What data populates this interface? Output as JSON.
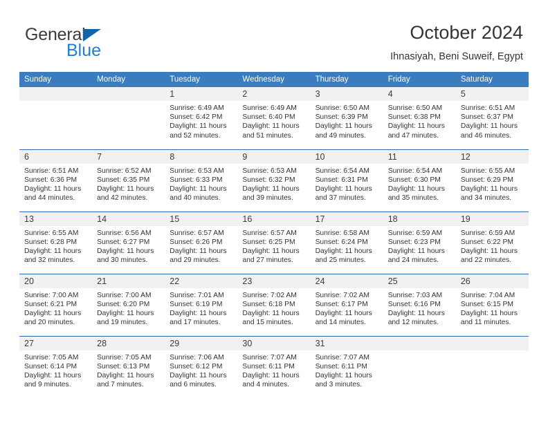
{
  "brand": {
    "name_part1": "General",
    "name_part2": "Blue",
    "triangle_icon": "triangle-icon"
  },
  "header": {
    "title": "October 2024",
    "subtitle": "Ihnasiyah, Beni Suweif, Egypt"
  },
  "colors": {
    "header_blue": "#3A7CC0",
    "row_divider_blue": "#2A6DB5",
    "daynum_band": "#F1F1F1",
    "brand_blue": "#1F7FD4",
    "text": "#333333"
  },
  "calendar": {
    "weekday_headers": [
      "Sunday",
      "Monday",
      "Tuesday",
      "Wednesday",
      "Thursday",
      "Friday",
      "Saturday"
    ],
    "weeks": [
      [
        {
          "day": "",
          "sunrise": "",
          "sunset": "",
          "daylight_line1": "",
          "daylight_line2": ""
        },
        {
          "day": "",
          "sunrise": "",
          "sunset": "",
          "daylight_line1": "",
          "daylight_line2": ""
        },
        {
          "day": "1",
          "sunrise": "Sunrise: 6:49 AM",
          "sunset": "Sunset: 6:42 PM",
          "daylight_line1": "Daylight: 11 hours",
          "daylight_line2": "and 52 minutes."
        },
        {
          "day": "2",
          "sunrise": "Sunrise: 6:49 AM",
          "sunset": "Sunset: 6:40 PM",
          "daylight_line1": "Daylight: 11 hours",
          "daylight_line2": "and 51 minutes."
        },
        {
          "day": "3",
          "sunrise": "Sunrise: 6:50 AM",
          "sunset": "Sunset: 6:39 PM",
          "daylight_line1": "Daylight: 11 hours",
          "daylight_line2": "and 49 minutes."
        },
        {
          "day": "4",
          "sunrise": "Sunrise: 6:50 AM",
          "sunset": "Sunset: 6:38 PM",
          "daylight_line1": "Daylight: 11 hours",
          "daylight_line2": "and 47 minutes."
        },
        {
          "day": "5",
          "sunrise": "Sunrise: 6:51 AM",
          "sunset": "Sunset: 6:37 PM",
          "daylight_line1": "Daylight: 11 hours",
          "daylight_line2": "and 46 minutes."
        }
      ],
      [
        {
          "day": "6",
          "sunrise": "Sunrise: 6:51 AM",
          "sunset": "Sunset: 6:36 PM",
          "daylight_line1": "Daylight: 11 hours",
          "daylight_line2": "and 44 minutes."
        },
        {
          "day": "7",
          "sunrise": "Sunrise: 6:52 AM",
          "sunset": "Sunset: 6:35 PM",
          "daylight_line1": "Daylight: 11 hours",
          "daylight_line2": "and 42 minutes."
        },
        {
          "day": "8",
          "sunrise": "Sunrise: 6:53 AM",
          "sunset": "Sunset: 6:33 PM",
          "daylight_line1": "Daylight: 11 hours",
          "daylight_line2": "and 40 minutes."
        },
        {
          "day": "9",
          "sunrise": "Sunrise: 6:53 AM",
          "sunset": "Sunset: 6:32 PM",
          "daylight_line1": "Daylight: 11 hours",
          "daylight_line2": "and 39 minutes."
        },
        {
          "day": "10",
          "sunrise": "Sunrise: 6:54 AM",
          "sunset": "Sunset: 6:31 PM",
          "daylight_line1": "Daylight: 11 hours",
          "daylight_line2": "and 37 minutes."
        },
        {
          "day": "11",
          "sunrise": "Sunrise: 6:54 AM",
          "sunset": "Sunset: 6:30 PM",
          "daylight_line1": "Daylight: 11 hours",
          "daylight_line2": "and 35 minutes."
        },
        {
          "day": "12",
          "sunrise": "Sunrise: 6:55 AM",
          "sunset": "Sunset: 6:29 PM",
          "daylight_line1": "Daylight: 11 hours",
          "daylight_line2": "and 34 minutes."
        }
      ],
      [
        {
          "day": "13",
          "sunrise": "Sunrise: 6:55 AM",
          "sunset": "Sunset: 6:28 PM",
          "daylight_line1": "Daylight: 11 hours",
          "daylight_line2": "and 32 minutes."
        },
        {
          "day": "14",
          "sunrise": "Sunrise: 6:56 AM",
          "sunset": "Sunset: 6:27 PM",
          "daylight_line1": "Daylight: 11 hours",
          "daylight_line2": "and 30 minutes."
        },
        {
          "day": "15",
          "sunrise": "Sunrise: 6:57 AM",
          "sunset": "Sunset: 6:26 PM",
          "daylight_line1": "Daylight: 11 hours",
          "daylight_line2": "and 29 minutes."
        },
        {
          "day": "16",
          "sunrise": "Sunrise: 6:57 AM",
          "sunset": "Sunset: 6:25 PM",
          "daylight_line1": "Daylight: 11 hours",
          "daylight_line2": "and 27 minutes."
        },
        {
          "day": "17",
          "sunrise": "Sunrise: 6:58 AM",
          "sunset": "Sunset: 6:24 PM",
          "daylight_line1": "Daylight: 11 hours",
          "daylight_line2": "and 25 minutes."
        },
        {
          "day": "18",
          "sunrise": "Sunrise: 6:59 AM",
          "sunset": "Sunset: 6:23 PM",
          "daylight_line1": "Daylight: 11 hours",
          "daylight_line2": "and 24 minutes."
        },
        {
          "day": "19",
          "sunrise": "Sunrise: 6:59 AM",
          "sunset": "Sunset: 6:22 PM",
          "daylight_line1": "Daylight: 11 hours",
          "daylight_line2": "and 22 minutes."
        }
      ],
      [
        {
          "day": "20",
          "sunrise": "Sunrise: 7:00 AM",
          "sunset": "Sunset: 6:21 PM",
          "daylight_line1": "Daylight: 11 hours",
          "daylight_line2": "and 20 minutes."
        },
        {
          "day": "21",
          "sunrise": "Sunrise: 7:00 AM",
          "sunset": "Sunset: 6:20 PM",
          "daylight_line1": "Daylight: 11 hours",
          "daylight_line2": "and 19 minutes."
        },
        {
          "day": "22",
          "sunrise": "Sunrise: 7:01 AM",
          "sunset": "Sunset: 6:19 PM",
          "daylight_line1": "Daylight: 11 hours",
          "daylight_line2": "and 17 minutes."
        },
        {
          "day": "23",
          "sunrise": "Sunrise: 7:02 AM",
          "sunset": "Sunset: 6:18 PM",
          "daylight_line1": "Daylight: 11 hours",
          "daylight_line2": "and 15 minutes."
        },
        {
          "day": "24",
          "sunrise": "Sunrise: 7:02 AM",
          "sunset": "Sunset: 6:17 PM",
          "daylight_line1": "Daylight: 11 hours",
          "daylight_line2": "and 14 minutes."
        },
        {
          "day": "25",
          "sunrise": "Sunrise: 7:03 AM",
          "sunset": "Sunset: 6:16 PM",
          "daylight_line1": "Daylight: 11 hours",
          "daylight_line2": "and 12 minutes."
        },
        {
          "day": "26",
          "sunrise": "Sunrise: 7:04 AM",
          "sunset": "Sunset: 6:15 PM",
          "daylight_line1": "Daylight: 11 hours",
          "daylight_line2": "and 11 minutes."
        }
      ],
      [
        {
          "day": "27",
          "sunrise": "Sunrise: 7:05 AM",
          "sunset": "Sunset: 6:14 PM",
          "daylight_line1": "Daylight: 11 hours",
          "daylight_line2": "and 9 minutes."
        },
        {
          "day": "28",
          "sunrise": "Sunrise: 7:05 AM",
          "sunset": "Sunset: 6:13 PM",
          "daylight_line1": "Daylight: 11 hours",
          "daylight_line2": "and 7 minutes."
        },
        {
          "day": "29",
          "sunrise": "Sunrise: 7:06 AM",
          "sunset": "Sunset: 6:12 PM",
          "daylight_line1": "Daylight: 11 hours",
          "daylight_line2": "and 6 minutes."
        },
        {
          "day": "30",
          "sunrise": "Sunrise: 7:07 AM",
          "sunset": "Sunset: 6:11 PM",
          "daylight_line1": "Daylight: 11 hours",
          "daylight_line2": "and 4 minutes."
        },
        {
          "day": "31",
          "sunrise": "Sunrise: 7:07 AM",
          "sunset": "Sunset: 6:11 PM",
          "daylight_line1": "Daylight: 11 hours",
          "daylight_line2": "and 3 minutes."
        },
        {
          "day": "",
          "sunrise": "",
          "sunset": "",
          "daylight_line1": "",
          "daylight_line2": ""
        },
        {
          "day": "",
          "sunrise": "",
          "sunset": "",
          "daylight_line1": "",
          "daylight_line2": ""
        }
      ]
    ]
  }
}
